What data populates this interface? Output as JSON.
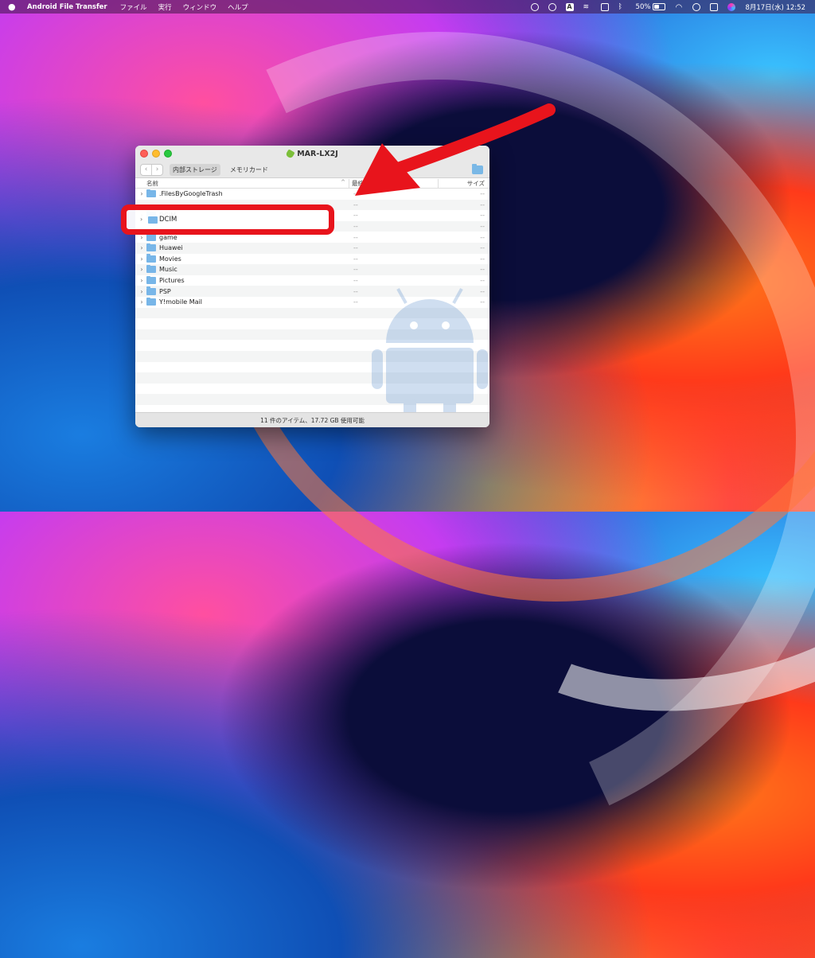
{
  "menubar": {
    "app_name": "Android File Transfer",
    "menus": [
      "ファイル",
      "実行",
      "ウィンドウ",
      "ヘルプ"
    ],
    "battery_percent": "50%",
    "datetime": "8月17日(水)  12:52",
    "battery_level": 0.5
  },
  "window": {
    "title": "MAR-LX2J",
    "tabs": [
      "内部ストレージ",
      "メモリカード"
    ],
    "active_tab": "内部ストレージ",
    "columns": {
      "name": "名前",
      "date": "最終更新日",
      "size": "サイズ"
    },
    "rows": [
      {
        "name": ".FilesByGoogleTrash",
        "date": "--",
        "size": "--"
      },
      {
        "name": "",
        "date": "--",
        "size": "--"
      },
      {
        "name": "DCIM",
        "date": "--",
        "size": "--"
      },
      {
        "name": "",
        "date": "--",
        "size": "--"
      },
      {
        "name": "game",
        "date": "--",
        "size": "--"
      },
      {
        "name": "Huawei",
        "date": "--",
        "size": "--"
      },
      {
        "name": "Movies",
        "date": "--",
        "size": "--"
      },
      {
        "name": "Music",
        "date": "--",
        "size": "--"
      },
      {
        "name": "Pictures",
        "date": "--",
        "size": "--"
      },
      {
        "name": "PSP",
        "date": "--",
        "size": "--"
      },
      {
        "name": "Y!mobile Mail",
        "date": "--",
        "size": "--"
      }
    ],
    "status": "11 件のアイテム、17.72 GB 使用可能"
  },
  "annotation": {
    "highlighted_item": "DCIM",
    "color": "#e8141c"
  }
}
